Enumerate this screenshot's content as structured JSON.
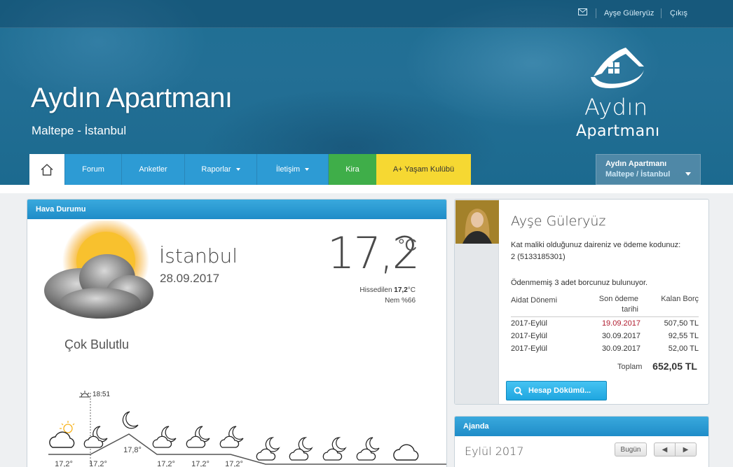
{
  "topbar": {
    "user_link": "Ayşe Güleryüz",
    "logout_link": "Çıkış"
  },
  "header": {
    "title": "Aydın Apartmanı",
    "subtitle": "Maltepe - İstanbul",
    "logo_line1": "Aydın",
    "logo_line2": "Apartmanı"
  },
  "nav": {
    "items": [
      {
        "label": "Forum"
      },
      {
        "label": "Anketler"
      },
      {
        "label": "Raporlar"
      },
      {
        "label": "İletişim"
      },
      {
        "label": "Kira"
      },
      {
        "label": "A+ Yaşam Kulübü"
      }
    ],
    "building_selector": {
      "name": "Aydın Apartmanı",
      "location": "Maltepe / İstanbul"
    }
  },
  "weather": {
    "panel_title": "Hava Durumu",
    "city": "İstanbul",
    "date": "28.09.2017",
    "temp": "17,2",
    "unit": "°C",
    "feels_label": "Hissedilen",
    "feels_value": "17,2",
    "feels_unit": "°C",
    "humidity": "Nem %66",
    "condition": "Çok Bulutlu",
    "sunset_time": "18:51",
    "forecast_labels": [
      "17,2°",
      "17,2°",
      "17,8°",
      "17,2°",
      "17,2°",
      "17,2°"
    ],
    "colors": {
      "sun": "#f7b21a",
      "line": "#555555"
    }
  },
  "profile": {
    "name": "Ayşe Güleryüz",
    "info_line": "Kat maliki olduğunuz daireniz ve ödeme kodunuz:",
    "code_line": "2 (5133185301)",
    "debt_notice": "Ödenmemiş 3 adet borcunuz bulunuyor.",
    "table": {
      "col1": "Aidat Dönemi",
      "col2a": "Son ödeme",
      "col2b": "tarihi",
      "col3": "Kalan Borç",
      "rows": [
        {
          "period": "2017-Eylül",
          "due": "19.09.2017",
          "amount": "507,50 TL"
        },
        {
          "period": "2017-Eylül",
          "due": "30.09.2017",
          "amount": "92,55 TL"
        },
        {
          "period": "2017-Eylül",
          "due": "30.09.2017",
          "amount": "52,00 TL"
        }
      ]
    },
    "total_label": "Toplam",
    "total_value": "652,05 TL",
    "statement_button": "Hesap Dökümü..."
  },
  "agenda": {
    "panel_title": "Ajanda",
    "month": "Eylül 2017",
    "today_button": "Bugün",
    "prev": "◀",
    "next": "▶"
  }
}
